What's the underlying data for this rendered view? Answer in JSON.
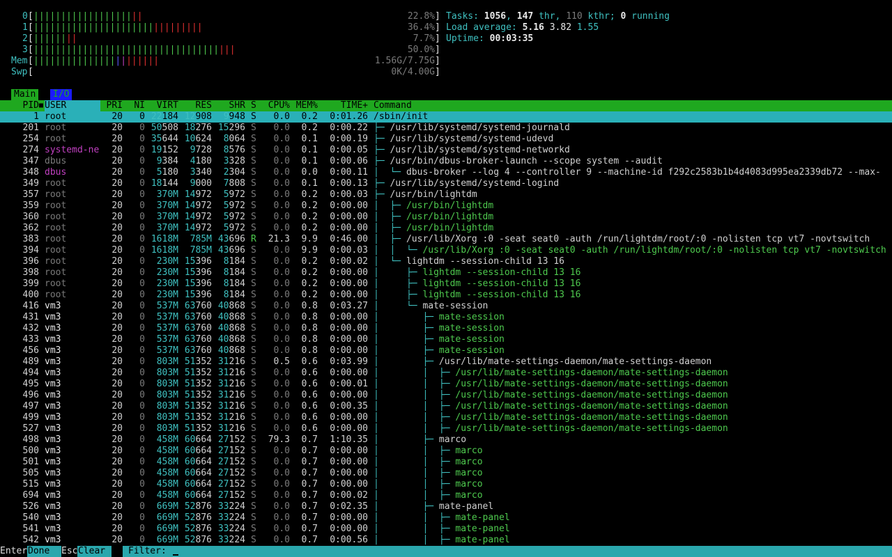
{
  "meters": {
    "cpu": [
      {
        "label": "0",
        "green": "||||||||||||||||||",
        "red": "||",
        "value": "22.8%"
      },
      {
        "label": "1",
        "green": "||||||||||||||||||||||",
        "red": "|||||||||",
        "value": "36.4%"
      },
      {
        "label": "2",
        "green": "||||||",
        "red": "||",
        "value": "7.7%"
      },
      {
        "label": "3",
        "green": "||||||||||||||||||||||||||||||||||",
        "red": "|||",
        "value": "50.0%"
      }
    ],
    "mem": {
      "label": "Mem",
      "green": "|||||||||||||||",
      "blue": "|",
      "mag": "|",
      "red": "||||||",
      "value": "1.56G/7.75G"
    },
    "swp": {
      "label": "Swp",
      "value": "0K/4.00G"
    }
  },
  "summary": {
    "tasks_label": "Tasks:",
    "tasks": "1056",
    "thr": "147",
    "thr_label": "thr,",
    "kthr": "110",
    "kthr_label": "kthr;",
    "running": "0",
    "running_label": "running",
    "load_label": "Load average:",
    "load1": "5.16",
    "load5": "3.82",
    "load15": "1.55",
    "uptime_label": "Uptime:",
    "uptime": "00:03:35"
  },
  "tabs": [
    "Main",
    "I/O"
  ],
  "columns": {
    "pid": "PID",
    "user": "USER",
    "pri": "PRI",
    "ni": "NI",
    "virt": "VIRT",
    "res": "RES",
    "shr": "SHR",
    "s": "S",
    "cpu": "CPU%",
    "mem": "MEM%",
    "time": "TIME+",
    "cmd": "Command"
  },
  "processes": [
    {
      "pid": "1",
      "user": "root",
      "pri": "20",
      "ni": "0",
      "virt": "22184",
      "res": "12908",
      "shr": "9948",
      "s": "S",
      "cpu": "0.0",
      "mem": "0.2",
      "time": "0:01.26",
      "cmd": "/sbin/init",
      "tree": "",
      "thread": false,
      "selected": true
    },
    {
      "pid": "201",
      "user": "root",
      "pri": "20",
      "ni": "0",
      "virt": "50508",
      "res": "18276",
      "shr": "15296",
      "s": "S",
      "cpu": "0.0",
      "mem": "0.2",
      "time": "0:00.22",
      "tree": "├─ ",
      "cmd": "/usr/lib/systemd/systemd-journald",
      "thread": false
    },
    {
      "pid": "254",
      "user": "root",
      "pri": "20",
      "ni": "0",
      "virt": "35644",
      "res": "10624",
      "shr": "8064",
      "s": "S",
      "cpu": "0.0",
      "mem": "0.1",
      "time": "0:00.19",
      "tree": "├─ ",
      "cmd": "/usr/lib/systemd/systemd-udevd",
      "thread": false
    },
    {
      "pid": "274",
      "user": "systemd-ne",
      "pri": "20",
      "ni": "0",
      "virt": "19152",
      "res": "9728",
      "shr": "8576",
      "s": "S",
      "cpu": "0.0",
      "mem": "0.1",
      "time": "0:00.05",
      "tree": "├─ ",
      "cmd": "/usr/lib/systemd/systemd-networkd",
      "thread": false
    },
    {
      "pid": "347",
      "user": "dbus",
      "pri": "20",
      "ni": "0",
      "virt": "9384",
      "res": "4180",
      "shr": "3328",
      "s": "S",
      "cpu": "0.0",
      "mem": "0.1",
      "time": "0:00.06",
      "tree": "├─ ",
      "cmd": "/usr/bin/dbus-broker-launch --scope system --audit",
      "thread": false
    },
    {
      "pid": "348",
      "user": "dbus",
      "pri": "20",
      "ni": "0",
      "virt": "5180",
      "res": "3340",
      "shr": "2304",
      "s": "S",
      "cpu": "0.0",
      "mem": "0.0",
      "time": "0:00.11",
      "tree": "│  └─ ",
      "cmd": "dbus-broker --log 4 --controller 9 --machine-id f292c2583b1b4d4083d995ea2339db72 --max-",
      "thread": false
    },
    {
      "pid": "349",
      "user": "root",
      "pri": "20",
      "ni": "0",
      "virt": "18144",
      "res": "9000",
      "shr": "7808",
      "s": "S",
      "cpu": "0.0",
      "mem": "0.1",
      "time": "0:00.13",
      "tree": "├─ ",
      "cmd": "/usr/lib/systemd/systemd-logind",
      "thread": false
    },
    {
      "pid": "357",
      "user": "root",
      "pri": "20",
      "ni": "0",
      "virt": "370M",
      "res": "14972",
      "shr": "5972",
      "s": "S",
      "cpu": "0.0",
      "mem": "0.2",
      "time": "0:00.03",
      "tree": "├─ ",
      "cmd": "/usr/bin/lightdm",
      "thread": false
    },
    {
      "pid": "359",
      "user": "root",
      "pri": "20",
      "ni": "0",
      "virt": "370M",
      "res": "14972",
      "shr": "5972",
      "s": "S",
      "cpu": "0.0",
      "mem": "0.2",
      "time": "0:00.00",
      "tree": "│  ├─ ",
      "cmd": "/usr/bin/lightdm",
      "thread": true
    },
    {
      "pid": "360",
      "user": "root",
      "pri": "20",
      "ni": "0",
      "virt": "370M",
      "res": "14972",
      "shr": "5972",
      "s": "S",
      "cpu": "0.0",
      "mem": "0.2",
      "time": "0:00.00",
      "tree": "│  ├─ ",
      "cmd": "/usr/bin/lightdm",
      "thread": true
    },
    {
      "pid": "362",
      "user": "root",
      "pri": "20",
      "ni": "0",
      "virt": "370M",
      "res": "14972",
      "shr": "5972",
      "s": "S",
      "cpu": "0.0",
      "mem": "0.2",
      "time": "0:00.00",
      "tree": "│  ├─ ",
      "cmd": "/usr/bin/lightdm",
      "thread": true
    },
    {
      "pid": "383",
      "user": "root",
      "pri": "20",
      "ni": "0",
      "virt": "1618M",
      "res": "785M",
      "shr": "43696",
      "s": "R",
      "cpu": "21.3",
      "mem": "9.9",
      "time": "0:46.00",
      "tree": "│  ├─ ",
      "cmd": "/usr/lib/Xorg :0 -seat seat0 -auth /run/lightdm/root/:0 -nolisten tcp vt7 -novtswitch",
      "thread": false
    },
    {
      "pid": "394",
      "user": "root",
      "pri": "20",
      "ni": "0",
      "virt": "1618M",
      "res": "785M",
      "shr": "43696",
      "s": "S",
      "cpu": "0.0",
      "mem": "9.9",
      "time": "0:00.03",
      "tree": "│  │  └─ ",
      "cmd": "/usr/lib/Xorg :0 -seat seat0 -auth /run/lightdm/root/:0 -nolisten tcp vt7 -novtswitch",
      "thread": true
    },
    {
      "pid": "396",
      "user": "root",
      "pri": "20",
      "ni": "0",
      "virt": "230M",
      "res": "15396",
      "shr": "8184",
      "s": "S",
      "cpu": "0.0",
      "mem": "0.2",
      "time": "0:00.02",
      "tree": "│  └─ ",
      "cmd": "lightdm --session-child 13 16",
      "thread": false
    },
    {
      "pid": "398",
      "user": "root",
      "pri": "20",
      "ni": "0",
      "virt": "230M",
      "res": "15396",
      "shr": "8184",
      "s": "S",
      "cpu": "0.0",
      "mem": "0.2",
      "time": "0:00.00",
      "tree": "│     ├─ ",
      "cmd": "lightdm --session-child 13 16",
      "thread": true
    },
    {
      "pid": "399",
      "user": "root",
      "pri": "20",
      "ni": "0",
      "virt": "230M",
      "res": "15396",
      "shr": "8184",
      "s": "S",
      "cpu": "0.0",
      "mem": "0.2",
      "time": "0:00.00",
      "tree": "│     ├─ ",
      "cmd": "lightdm --session-child 13 16",
      "thread": true
    },
    {
      "pid": "400",
      "user": "root",
      "pri": "20",
      "ni": "0",
      "virt": "230M",
      "res": "15396",
      "shr": "8184",
      "s": "S",
      "cpu": "0.0",
      "mem": "0.2",
      "time": "0:00.00",
      "tree": "│     ├─ ",
      "cmd": "lightdm --session-child 13 16",
      "thread": true
    },
    {
      "pid": "416",
      "user": "vm3",
      "pri": "20",
      "ni": "0",
      "virt": "537M",
      "res": "63760",
      "shr": "40868",
      "s": "S",
      "cpu": "0.0",
      "mem": "0.8",
      "time": "0:03.27",
      "tree": "│     └─ ",
      "cmd": "mate-session",
      "thread": false
    },
    {
      "pid": "431",
      "user": "vm3",
      "pri": "20",
      "ni": "0",
      "virt": "537M",
      "res": "63760",
      "shr": "40868",
      "s": "S",
      "cpu": "0.0",
      "mem": "0.8",
      "time": "0:00.00",
      "tree": "│        ├─ ",
      "cmd": "mate-session",
      "thread": true
    },
    {
      "pid": "432",
      "user": "vm3",
      "pri": "20",
      "ni": "0",
      "virt": "537M",
      "res": "63760",
      "shr": "40868",
      "s": "S",
      "cpu": "0.0",
      "mem": "0.8",
      "time": "0:00.00",
      "tree": "│        ├─ ",
      "cmd": "mate-session",
      "thread": true
    },
    {
      "pid": "433",
      "user": "vm3",
      "pri": "20",
      "ni": "0",
      "virt": "537M",
      "res": "63760",
      "shr": "40868",
      "s": "S",
      "cpu": "0.0",
      "mem": "0.8",
      "time": "0:00.00",
      "tree": "│        ├─ ",
      "cmd": "mate-session",
      "thread": true
    },
    {
      "pid": "456",
      "user": "vm3",
      "pri": "20",
      "ni": "0",
      "virt": "537M",
      "res": "63760",
      "shr": "40868",
      "s": "S",
      "cpu": "0.0",
      "mem": "0.8",
      "time": "0:00.00",
      "tree": "│        ├─ ",
      "cmd": "mate-session",
      "thread": true
    },
    {
      "pid": "489",
      "user": "vm3",
      "pri": "20",
      "ni": "0",
      "virt": "803M",
      "res": "51352",
      "shr": "31216",
      "s": "S",
      "cpu": "0.5",
      "mem": "0.6",
      "time": "0:03.99",
      "tree": "│        ├─ ",
      "cmd": "/usr/lib/mate-settings-daemon/mate-settings-daemon",
      "thread": false
    },
    {
      "pid": "494",
      "user": "vm3",
      "pri": "20",
      "ni": "0",
      "virt": "803M",
      "res": "51352",
      "shr": "31216",
      "s": "S",
      "cpu": "0.0",
      "mem": "0.6",
      "time": "0:00.00",
      "tree": "│        │  ├─ ",
      "cmd": "/usr/lib/mate-settings-daemon/mate-settings-daemon",
      "thread": true
    },
    {
      "pid": "495",
      "user": "vm3",
      "pri": "20",
      "ni": "0",
      "virt": "803M",
      "res": "51352",
      "shr": "31216",
      "s": "S",
      "cpu": "0.0",
      "mem": "0.6",
      "time": "0:00.01",
      "tree": "│        │  ├─ ",
      "cmd": "/usr/lib/mate-settings-daemon/mate-settings-daemon",
      "thread": true
    },
    {
      "pid": "496",
      "user": "vm3",
      "pri": "20",
      "ni": "0",
      "virt": "803M",
      "res": "51352",
      "shr": "31216",
      "s": "S",
      "cpu": "0.0",
      "mem": "0.6",
      "time": "0:00.00",
      "tree": "│        │  ├─ ",
      "cmd": "/usr/lib/mate-settings-daemon/mate-settings-daemon",
      "thread": true
    },
    {
      "pid": "497",
      "user": "vm3",
      "pri": "20",
      "ni": "0",
      "virt": "803M",
      "res": "51352",
      "shr": "31216",
      "s": "S",
      "cpu": "0.0",
      "mem": "0.6",
      "time": "0:00.35",
      "tree": "│        │  ├─ ",
      "cmd": "/usr/lib/mate-settings-daemon/mate-settings-daemon",
      "thread": true
    },
    {
      "pid": "499",
      "user": "vm3",
      "pri": "20",
      "ni": "0",
      "virt": "803M",
      "res": "51352",
      "shr": "31216",
      "s": "S",
      "cpu": "0.0",
      "mem": "0.6",
      "time": "0:00.00",
      "tree": "│        │  ├─ ",
      "cmd": "/usr/lib/mate-settings-daemon/mate-settings-daemon",
      "thread": true
    },
    {
      "pid": "527",
      "user": "vm3",
      "pri": "20",
      "ni": "0",
      "virt": "803M",
      "res": "51352",
      "shr": "31216",
      "s": "S",
      "cpu": "0.0",
      "mem": "0.6",
      "time": "0:00.00",
      "tree": "│        │  ├─ ",
      "cmd": "/usr/lib/mate-settings-daemon/mate-settings-daemon",
      "thread": true
    },
    {
      "pid": "498",
      "user": "vm3",
      "pri": "20",
      "ni": "0",
      "virt": "458M",
      "res": "60664",
      "shr": "27152",
      "s": "S",
      "cpu": "79.3",
      "mem": "0.7",
      "time": "1:10.35",
      "tree": "│        ├─ ",
      "cmd": "marco",
      "thread": false
    },
    {
      "pid": "500",
      "user": "vm3",
      "pri": "20",
      "ni": "0",
      "virt": "458M",
      "res": "60664",
      "shr": "27152",
      "s": "S",
      "cpu": "0.0",
      "mem": "0.7",
      "time": "0:00.00",
      "tree": "│        │  ├─ ",
      "cmd": "marco",
      "thread": true
    },
    {
      "pid": "501",
      "user": "vm3",
      "pri": "20",
      "ni": "0",
      "virt": "458M",
      "res": "60664",
      "shr": "27152",
      "s": "S",
      "cpu": "0.0",
      "mem": "0.7",
      "time": "0:00.00",
      "tree": "│        │  ├─ ",
      "cmd": "marco",
      "thread": true
    },
    {
      "pid": "505",
      "user": "vm3",
      "pri": "20",
      "ni": "0",
      "virt": "458M",
      "res": "60664",
      "shr": "27152",
      "s": "S",
      "cpu": "0.0",
      "mem": "0.7",
      "time": "0:00.00",
      "tree": "│        │  ├─ ",
      "cmd": "marco",
      "thread": true
    },
    {
      "pid": "515",
      "user": "vm3",
      "pri": "20",
      "ni": "0",
      "virt": "458M",
      "res": "60664",
      "shr": "27152",
      "s": "S",
      "cpu": "0.0",
      "mem": "0.7",
      "time": "0:00.00",
      "tree": "│        │  ├─ ",
      "cmd": "marco",
      "thread": true
    },
    {
      "pid": "694",
      "user": "vm3",
      "pri": "20",
      "ni": "0",
      "virt": "458M",
      "res": "60664",
      "shr": "27152",
      "s": "S",
      "cpu": "0.0",
      "mem": "0.7",
      "time": "0:00.02",
      "tree": "│        │  ├─ ",
      "cmd": "marco",
      "thread": true
    },
    {
      "pid": "526",
      "user": "vm3",
      "pri": "20",
      "ni": "0",
      "virt": "669M",
      "res": "52876",
      "shr": "33224",
      "s": "S",
      "cpu": "0.0",
      "mem": "0.7",
      "time": "0:02.35",
      "tree": "│        ├─ ",
      "cmd": "mate-panel",
      "thread": false
    },
    {
      "pid": "540",
      "user": "vm3",
      "pri": "20",
      "ni": "0",
      "virt": "669M",
      "res": "52876",
      "shr": "33224",
      "s": "S",
      "cpu": "0.0",
      "mem": "0.7",
      "time": "0:00.00",
      "tree": "│        │  ├─ ",
      "cmd": "mate-panel",
      "thread": true
    },
    {
      "pid": "541",
      "user": "vm3",
      "pri": "20",
      "ni": "0",
      "virt": "669M",
      "res": "52876",
      "shr": "33224",
      "s": "S",
      "cpu": "0.0",
      "mem": "0.7",
      "time": "0:00.00",
      "tree": "│        │  ├─ ",
      "cmd": "mate-panel",
      "thread": true
    },
    {
      "pid": "542",
      "user": "vm3",
      "pri": "20",
      "ni": "0",
      "virt": "669M",
      "res": "52876",
      "shr": "33224",
      "s": "S",
      "cpu": "0.0",
      "mem": "0.7",
      "time": "0:00.56",
      "tree": "│        │  ├─ ",
      "cmd": "mate-panel",
      "thread": true
    }
  ],
  "footer": {
    "enter_key": "Enter",
    "enter_label": "Done",
    "esc_key": "Esc",
    "esc_label": "Clear",
    "filter_label": "Filter:",
    "filter_value": ""
  },
  "colors": {
    "header_bar": "#1fa81f",
    "selected_row": "#2ab0b8",
    "footer_bar": "#2aa7ad",
    "thread_green": "#4ec94e",
    "cyan": "#3fc0c0"
  }
}
